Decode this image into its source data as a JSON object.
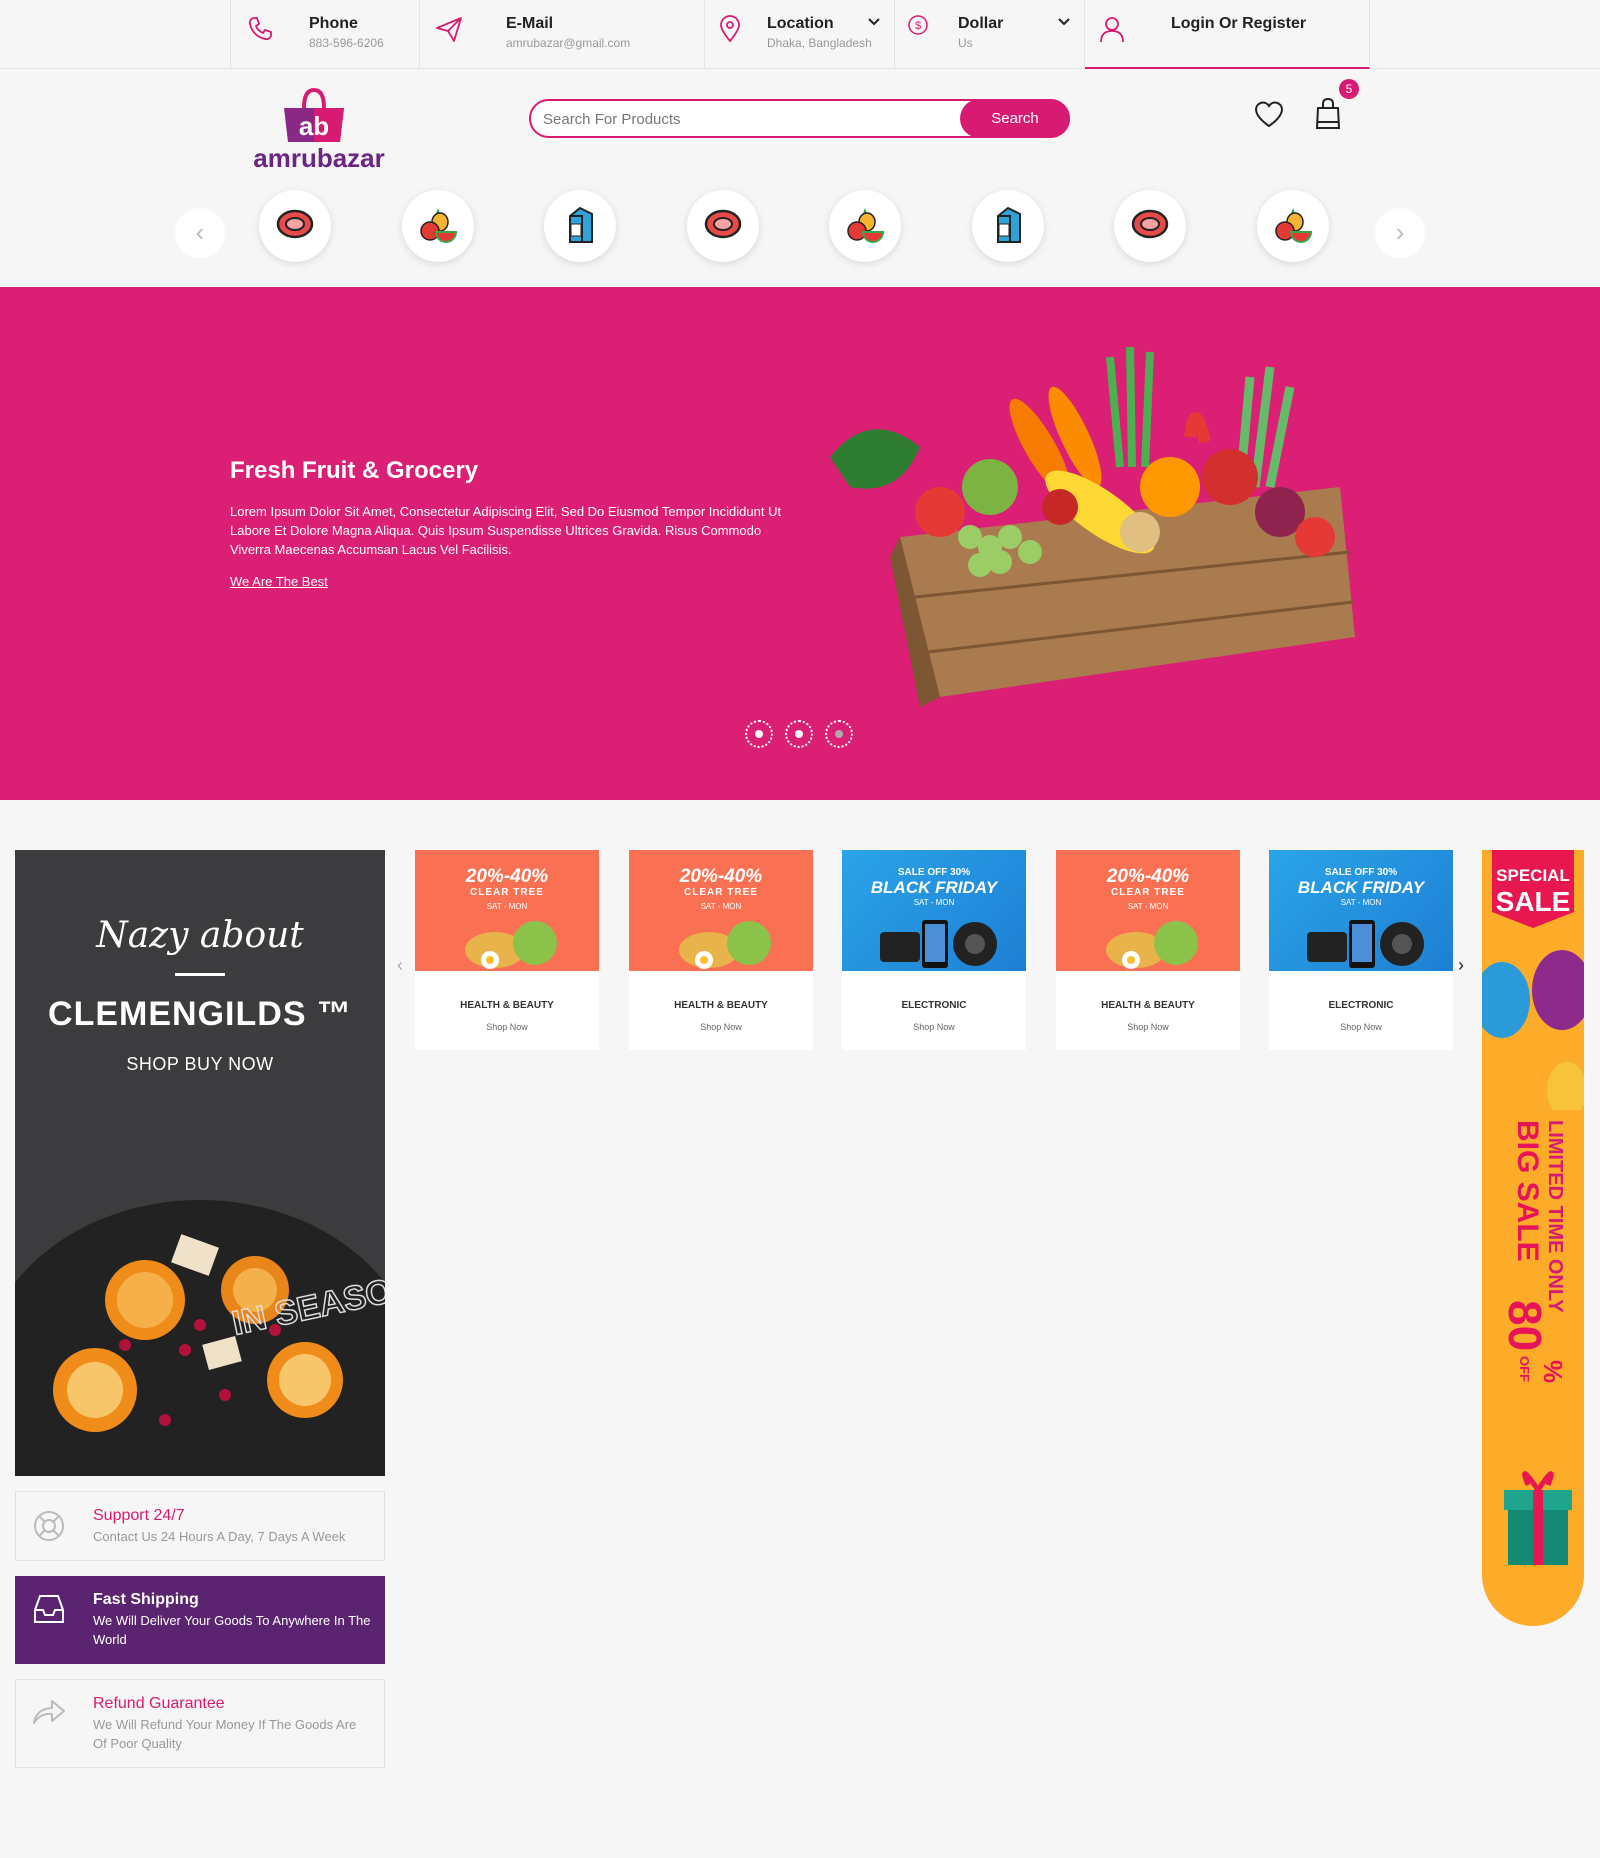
{
  "topbar": {
    "phone": {
      "title": "Phone",
      "value": "883-596-6206",
      "icon": "phone-icon"
    },
    "email": {
      "title": "E-Mail",
      "value": "amrubazar@gmail.com",
      "icon": "paper-plane-icon"
    },
    "location": {
      "title": "Location",
      "value": "Dhaka, Bangladesh",
      "icon": "map-pin-icon"
    },
    "currency": {
      "title": "Dollar",
      "value": "Us",
      "icon": "dollar-circle-icon"
    },
    "login": {
      "label": "Login Or Register",
      "icon": "user-icon"
    }
  },
  "header": {
    "logo_mark": "ab",
    "logo_text": "amrubazar",
    "search_placeholder": "Search For Products",
    "search_button": "Search",
    "cart_count": "5"
  },
  "categories": [
    "meat",
    "fruit",
    "milk",
    "meat",
    "fruit",
    "milk",
    "meat",
    "fruit"
  ],
  "hero": {
    "title": "Fresh Fruit & Grocery",
    "description": "Lorem Ipsum Dolor Sit Amet, Consectetur Adipiscing Elit, Sed Do Eiusmod Tempor Incididunt Ut Labore Et Dolore Magna Aliqua. Quis Ipsum Suspendisse Ultrices Gravida. Risus Commodo Viverra Maecenas Accumsan Lacus Vel Facilisis.",
    "link": "We Are The Best",
    "slides": 3,
    "active_slide": 3
  },
  "promo": {
    "script_text": "Nazy about",
    "brand": "CLEMENGILDS ™",
    "cta": "SHOP BUY NOW",
    "overlay": "IN SEASON"
  },
  "features": [
    {
      "title": "Support 24/7",
      "desc": "Contact Us 24 Hours A Day, 7 Days A Week",
      "icon": "lifebuoy-icon"
    },
    {
      "title": "Fast Shipping",
      "desc": "We Will Deliver Your Goods To Anywhere In The World",
      "icon": "inbox-tray-icon"
    },
    {
      "title": "Refund Guarantee",
      "desc": "We Will Refund Your Money If The Goods Are Of Poor Quality",
      "icon": "share-arrow-icon"
    }
  ],
  "products": [
    {
      "type": "orange",
      "big": "20%-40%",
      "mid": "CLEAR TREE",
      "small": "SAT - MON",
      "name": "HEALTH & BEAUTY",
      "link": "Shop Now"
    },
    {
      "type": "orange",
      "big": "20%-40%",
      "mid": "CLEAR TREE",
      "small": "SAT - MON",
      "name": "HEALTH & BEAUTY",
      "link": "Shop Now"
    },
    {
      "type": "blue",
      "big": "BLACK FRIDAY",
      "mid": "SALE OFF 30%",
      "small": "SAT - MON",
      "name": "ELECTRONIC",
      "link": "Shop Now"
    },
    {
      "type": "orange",
      "big": "20%-40%",
      "mid": "CLEAR TREE",
      "small": "SAT - MON",
      "name": "HEALTH & BEAUTY",
      "link": "Shop Now"
    },
    {
      "type": "blue",
      "big": "BLACK FRIDAY",
      "mid": "SALE OFF 30%",
      "small": "SAT - MON",
      "name": "ELECTRONIC",
      "link": "Shop Now"
    }
  ],
  "side_banner": {
    "special": "SPECIAL",
    "sale": "SALE",
    "limited": "LIMITED TIME ONLY",
    "big_sale": "BIG SALE",
    "percent": "80",
    "percent_sign": "%",
    "off": "OFF"
  },
  "colors": {
    "brand": "#d81b72",
    "purple": "#5b2470",
    "hero": "#db1f74"
  }
}
